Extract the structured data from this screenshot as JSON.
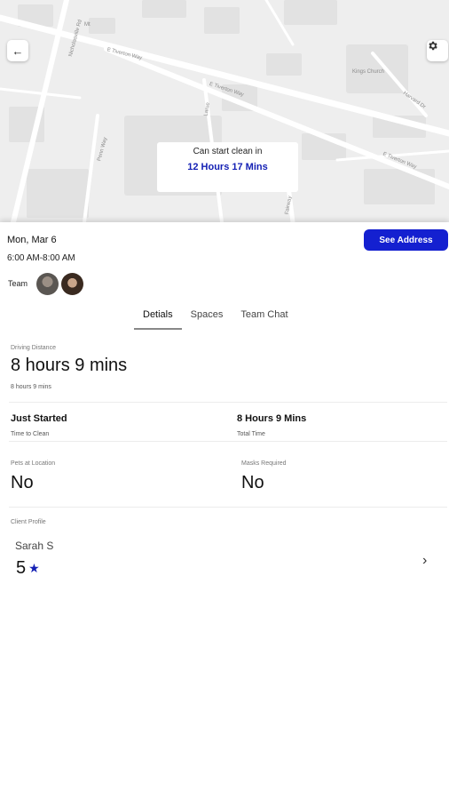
{
  "map": {
    "streets": [
      "Nicholasville Rd",
      "E Tiverton Way",
      "E Tiverton Way",
      "Larue",
      "E Tiverton Way",
      "Harvard Dr",
      "Penn Way",
      "Kings Church",
      "Fairway",
      "Mt"
    ],
    "timer_caption": "Can start clean in",
    "timer_value": "12 Hours 17 Mins"
  },
  "job": {
    "date": "Mon, Mar 6",
    "time_window": "6:00 AM-8:00 AM",
    "see_address_label": "See Address",
    "team_label": "Team"
  },
  "tabs": [
    "Detials",
    "Spaces",
    "Team Chat"
  ],
  "details": {
    "driving_distance_label": "Driving Distance",
    "driving_distance_value": "8 hours 9 mins",
    "driving_distance_sub": "8 hours 9 mins",
    "time_to_clean_value": "Just Started",
    "time_to_clean_label": "Time to Clean",
    "total_time_value": "8 Hours 9 Mins",
    "total_time_label": "Total Time",
    "pets_label": "Pets at Location",
    "pets_value": "No",
    "masks_label": "Masks Required",
    "masks_value": "No",
    "client_profile_label": "Client Profile",
    "client_name": "Sarah S",
    "client_rating": "5"
  },
  "icons": {
    "back": "arrow-left-icon",
    "settings": "gear-icon",
    "star": "star-icon",
    "chevron": "chevron-right-icon"
  },
  "colors": {
    "accent": "#1420d0",
    "map_bg": "#eeeeee"
  }
}
